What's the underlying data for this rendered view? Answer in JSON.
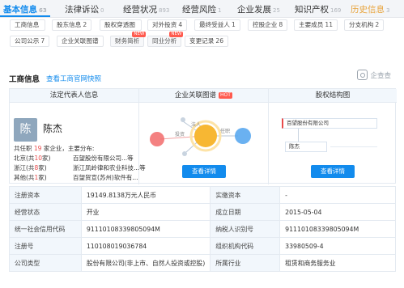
{
  "top_tabs": [
    {
      "label": "基本信息",
      "count": "63"
    },
    {
      "label": "法律诉讼",
      "count": "0"
    },
    {
      "label": "经营状况",
      "count": "893"
    },
    {
      "label": "经营风险",
      "count": "1"
    },
    {
      "label": "企业发展",
      "count": "25"
    },
    {
      "label": "知识产权",
      "count": "169"
    },
    {
      "label": "历史信息",
      "count": "3"
    }
  ],
  "sub_tabs_row1": [
    {
      "label": "工商信息",
      "count": ""
    },
    {
      "label": "股东信息",
      "count": "2"
    },
    {
      "label": "股权穿透图",
      "count": ""
    },
    {
      "label": "对外投资",
      "count": "4"
    },
    {
      "label": "最终受益人",
      "count": "1"
    },
    {
      "label": "控股企业",
      "count": "8"
    },
    {
      "label": "主要成员",
      "count": "11"
    },
    {
      "label": "分支机构",
      "count": "2"
    }
  ],
  "sub_tabs_row2": [
    {
      "label": "公司公示",
      "count": "7",
      "new": ""
    },
    {
      "label": "企业关联图谱",
      "count": "",
      "new": ""
    },
    {
      "label": "财务简析",
      "count": "",
      "new": "NEW"
    },
    {
      "label": "同业分析",
      "count": "",
      "new": "NEW"
    },
    {
      "label": "变更记录",
      "count": "26",
      "new": ""
    }
  ],
  "section": {
    "title": "工商信息",
    "link": "查看工商官网快照",
    "logo": "企查查"
  },
  "cards": {
    "legal_rep": {
      "header": "法定代表人信息",
      "avatar_char": "陈",
      "name": "陈杰",
      "summary_prefix": "共任职",
      "summary_count": "19",
      "summary_suffix": "家企业，主要分布:",
      "rows": [
        {
          "region": "北京",
          "count": "10",
          "company": "百望股份有限公司...等"
        },
        {
          "region": "浙江",
          "count": "8",
          "company": "浙江凤岭律和农业科技...等"
        },
        {
          "region": "其他",
          "count": "1",
          "company": "百望贸宣(苏州)软件有..."
        }
      ],
      "region_open": "(共",
      "region_close": "家)",
      "button": "查看详情"
    },
    "graph": {
      "header": "企业关联图谱",
      "hot": "HOT",
      "edge_invest": "投资",
      "edge_legal": "法人",
      "edge_appoint": "任职",
      "button": "查看详情"
    },
    "equity": {
      "header": "股权结构图",
      "company": "百望股份有限公司",
      "person": "陈杰",
      "button": "查看详情"
    }
  },
  "info_table": [
    [
      "注册资本",
      "19149.8138万元人民币",
      "实缴资本",
      "-"
    ],
    [
      "经营状态",
      "开业",
      "成立日期",
      "2015-05-04"
    ],
    [
      "统一社会信用代码",
      "911101083398050​94M",
      "纳税人识别号",
      "911101083398050​94M"
    ],
    [
      "注册号",
      "110108019036784",
      "组织机构代码",
      "33980509-4"
    ],
    [
      "公司类型",
      "股份有限公司(非上市、自然人投资或控股)",
      "所属行业",
      "租赁和商务服务业"
    ]
  ],
  "colors": {
    "accent": "#128bed",
    "history": "#e8a33a",
    "highlight": "#e84a4a",
    "node_orange": "#f7b733",
    "node_blue": "#5aa8f0",
    "node_red": "#f26b6b"
  }
}
